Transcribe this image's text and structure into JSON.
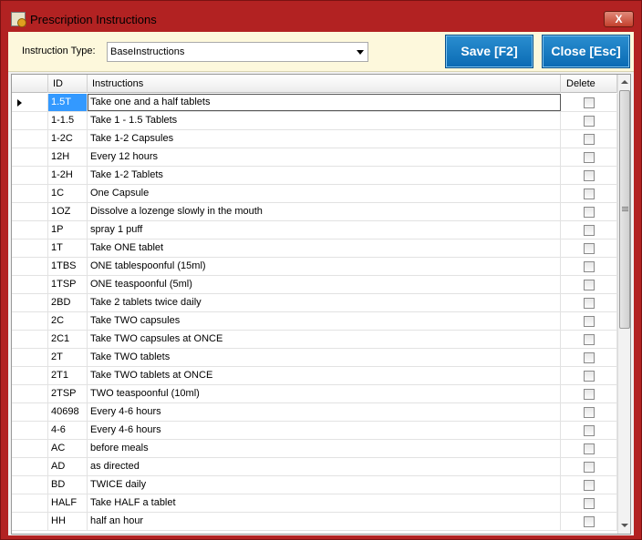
{
  "window": {
    "title": "Prescription Instructions",
    "close_label": "X"
  },
  "toolbar": {
    "instruction_type_label": "Instruction Type:",
    "instruction_type_value": "BaseInstructions",
    "save_label": "Save [F2]",
    "close_label": "Close [Esc]"
  },
  "grid": {
    "columns": {
      "id": "ID",
      "instructions": "Instructions",
      "delete": "Delete"
    },
    "rows": [
      {
        "id": "1.5T",
        "instructions": "Take one and a half tablets",
        "delete": false
      },
      {
        "id": "1-1.5",
        "instructions": "Take 1 - 1.5 Tablets",
        "delete": false
      },
      {
        "id": "1-2C",
        "instructions": "Take 1-2 Capsules",
        "delete": false
      },
      {
        "id": "12H",
        "instructions": "Every 12 hours",
        "delete": false
      },
      {
        "id": "1-2H",
        "instructions": "Take 1-2 Tablets",
        "delete": false
      },
      {
        "id": "1C",
        "instructions": "One Capsule",
        "delete": false
      },
      {
        "id": "1OZ",
        "instructions": "Dissolve a lozenge slowly in the mouth",
        "delete": false
      },
      {
        "id": "1P",
        "instructions": "spray 1 puff",
        "delete": false
      },
      {
        "id": "1T",
        "instructions": "Take ONE tablet",
        "delete": false
      },
      {
        "id": "1TBS",
        "instructions": "ONE tablespoonful (15ml)",
        "delete": false
      },
      {
        "id": "1TSP",
        "instructions": "ONE teaspoonful (5ml)",
        "delete": false
      },
      {
        "id": "2BD",
        "instructions": "Take 2 tablets twice daily",
        "delete": false
      },
      {
        "id": "2C",
        "instructions": "Take TWO capsules",
        "delete": false
      },
      {
        "id": "2C1",
        "instructions": "Take TWO capsules at ONCE",
        "delete": false
      },
      {
        "id": "2T",
        "instructions": "Take TWO tablets",
        "delete": false
      },
      {
        "id": "2T1",
        "instructions": "Take TWO tablets at ONCE",
        "delete": false
      },
      {
        "id": "2TSP",
        "instructions": "TWO teaspoonful (10ml)",
        "delete": false
      },
      {
        "id": "40698",
        "instructions": "Every 4-6 hours",
        "delete": false
      },
      {
        "id": "4-6",
        "instructions": "Every 4-6 hours",
        "delete": false
      },
      {
        "id": "AC",
        "instructions": "before meals",
        "delete": false
      },
      {
        "id": "AD",
        "instructions": "as directed",
        "delete": false
      },
      {
        "id": "BD",
        "instructions": "TWICE daily",
        "delete": false
      },
      {
        "id": "HALF",
        "instructions": "Take HALF a tablet",
        "delete": false
      },
      {
        "id": "HH",
        "instructions": "half an hour",
        "delete": false
      }
    ]
  }
}
